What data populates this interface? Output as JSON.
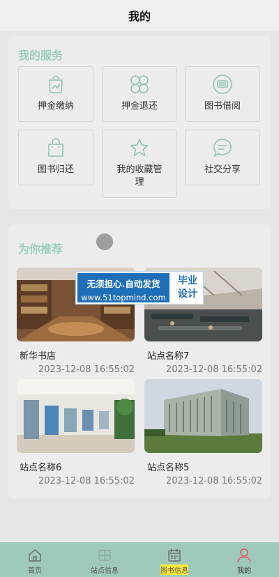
{
  "header": {
    "title": "我的"
  },
  "services": {
    "title": "我的服务",
    "items": [
      {
        "label": "押金缴纳",
        "icon": "shopping-bag-chart-icon"
      },
      {
        "label": "押金退还",
        "icon": "grid-circles-icon"
      },
      {
        "label": "图书借阅",
        "icon": "keyboard-circle-icon"
      },
      {
        "label": "图书归还",
        "icon": "shopping-bag-icon"
      },
      {
        "label": "我的收藏管理",
        "icon": "star-icon"
      },
      {
        "label": "社交分享",
        "icon": "chat-bubble-icon"
      }
    ]
  },
  "recommend": {
    "title": "为你推荐",
    "items": [
      {
        "name": "新华书店",
        "date": "2023-12-08 16:55:02"
      },
      {
        "name": "站点名称7",
        "date": "2023-12-08 16:55:02"
      },
      {
        "name": "站点名称6",
        "date": "2023-12-08 16:55:02"
      },
      {
        "name": "站点名称5",
        "date": "2023-12-08 16:55:02"
      }
    ]
  },
  "watermark": {
    "line1": "无须担心.自动发货",
    "line2": "www.51topmind.com",
    "right1": "毕业",
    "right2": "设计"
  },
  "tabbar": {
    "items": [
      {
        "label": "首页",
        "icon": "home-icon"
      },
      {
        "label": "站点信息",
        "icon": "grid-icon"
      },
      {
        "label": "图书信息",
        "icon": "calendar-icon"
      },
      {
        "label": "我的",
        "icon": "user-icon"
      }
    ],
    "active_color": "#e05a5a",
    "background": "#9fcabb"
  },
  "colors": {
    "accent": "#9ccfbd",
    "background": "#e6e6e6"
  }
}
